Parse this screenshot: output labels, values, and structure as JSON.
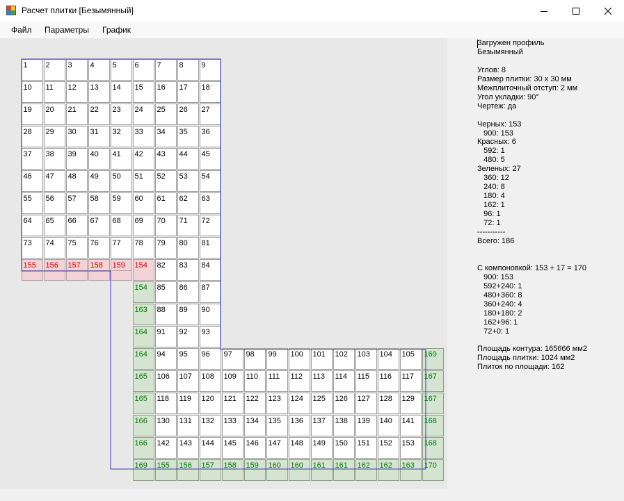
{
  "window": {
    "title": "Расчет плитки [Безымянный]"
  },
  "menu": [
    "Файл",
    "Параметры",
    "График"
  ],
  "colors": {
    "outline": "#3a3ab8",
    "tile_border": "#a0a0a0",
    "red_fill": "#f2d3d8",
    "red_text": "#cc0000",
    "green_fill": "#d5e4d1",
    "green_text": "#007a00",
    "canvas_bg": "#e8e8e8"
  },
  "info_lines": [
    "Загружен профиль",
    "Безымянный",
    "",
    "Углов: 8",
    "Размер плитки: 30 x 30 мм",
    "Межплиточный отступ: 2 мм",
    "Угол укладки: 90°",
    "Чертеж: да",
    "",
    "Черных: 153",
    "   900: 153",
    "Красных: 6",
    "   592: 1",
    "   480: 5",
    "Зеленых: 27",
    "   360: 12",
    "   240: 8",
    "   180: 4",
    "   162: 1",
    "   96: 1",
    "   72: 1",
    "-----------",
    "Всего: 186",
    "",
    "",
    "С компоновкой: 153 + 17 = 170",
    "   900: 153",
    "   592+240: 1",
    "   480+360: 8",
    "   360+240: 4",
    "   180+180: 2",
    "   162+96: 1",
    "   72+0: 1",
    "",
    "Площадь контура: 165666 мм2",
    "Площадь плитки: 1024 мм2",
    "Плиток по площади: 162"
  ],
  "tiles": {
    "black_rows_top": [
      [
        "1",
        "2",
        "3",
        "4",
        "5",
        "6",
        "7",
        "8",
        "9"
      ],
      [
        "10",
        "11",
        "12",
        "13",
        "14",
        "15",
        "16",
        "17",
        "18"
      ],
      [
        "19",
        "20",
        "21",
        "22",
        "23",
        "24",
        "25",
        "26",
        "27"
      ],
      [
        "28",
        "29",
        "30",
        "31",
        "32",
        "33",
        "34",
        "35",
        "36"
      ],
      [
        "37",
        "38",
        "39",
        "40",
        "41",
        "42",
        "43",
        "44",
        "45"
      ],
      [
        "46",
        "47",
        "48",
        "49",
        "50",
        "51",
        "52",
        "53",
        "54"
      ],
      [
        "55",
        "56",
        "57",
        "58",
        "59",
        "60",
        "61",
        "62",
        "63"
      ],
      [
        "64",
        "65",
        "66",
        "67",
        "68",
        "69",
        "70",
        "71",
        "72"
      ],
      [
        "73",
        "74",
        "75",
        "76",
        "77",
        "78",
        "79",
        "80",
        "81"
      ]
    ],
    "row10_red": [
      "155",
      "156",
      "157",
      "158",
      "159",
      "154"
    ],
    "row10_black": [
      "82",
      "83",
      "84"
    ],
    "mid_rows": [
      {
        "green": "154",
        "black": [
          "85",
          "86",
          "87"
        ]
      },
      {
        "green": "163",
        "black": [
          "88",
          "89",
          "90"
        ]
      },
      {
        "green": "164",
        "black": [
          "91",
          "92",
          "93"
        ]
      }
    ],
    "bottom_rows": [
      {
        "left": "164",
        "black": [
          "94",
          "95",
          "96",
          "97",
          "98",
          "99",
          "100",
          "101",
          "102",
          "103",
          "104",
          "105"
        ],
        "right": "169"
      },
      {
        "left": "165",
        "black": [
          "106",
          "107",
          "108",
          "109",
          "110",
          "111",
          "112",
          "113",
          "114",
          "115",
          "116",
          "117"
        ],
        "right": "167"
      },
      {
        "left": "165",
        "black": [
          "118",
          "119",
          "120",
          "121",
          "122",
          "123",
          "124",
          "125",
          "126",
          "127",
          "128",
          "129"
        ],
        "right": "167"
      },
      {
        "left": "166",
        "black": [
          "130",
          "131",
          "132",
          "133",
          "134",
          "135",
          "136",
          "137",
          "138",
          "139",
          "140",
          "141"
        ],
        "right": "168"
      },
      {
        "left": "166",
        "black": [
          "142",
          "143",
          "144",
          "145",
          "146",
          "147",
          "148",
          "149",
          "150",
          "151",
          "152",
          "153"
        ],
        "right": "168"
      }
    ],
    "last_row": [
      "169",
      "155",
      "156",
      "157",
      "158",
      "159",
      "160",
      "160",
      "161",
      "161",
      "162",
      "162",
      "163",
      "170"
    ]
  }
}
